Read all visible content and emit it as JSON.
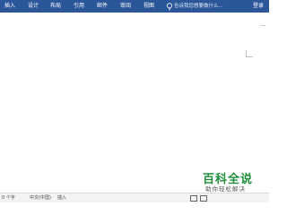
{
  "ribbon": {
    "tabs": [
      "插入",
      "设计",
      "布局",
      "引用",
      "邮件",
      "审阅",
      "视图"
    ],
    "tell_me": "告诉我您想要做什么...",
    "login": "登录"
  },
  "status": {
    "left": "0 个字",
    "language": "中文(中国)",
    "insert": "插入"
  },
  "watermark": {
    "title": "百科全说",
    "subtitle": "助你轻松解决"
  },
  "colors": {
    "ribbon": "#2b579a",
    "watermark": "#1e8f3a"
  }
}
